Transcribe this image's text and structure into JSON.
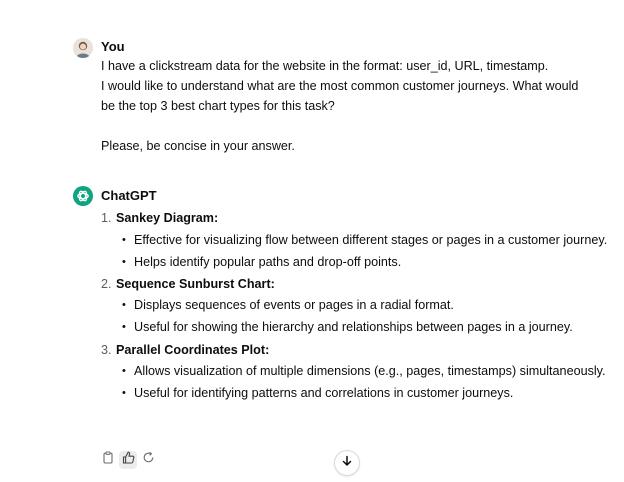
{
  "user_message": {
    "author": "You",
    "line1": "I have a clickstream data for the website in the format: user_id, URL, timestamp.",
    "line2": "I would like to understand what are the most common customer journeys. What would",
    "line3": "be the top 3 best chart types for this task?",
    "line4": "Please, be concise in your answer."
  },
  "assistant_message": {
    "author": "ChatGPT",
    "items": [
      {
        "number": "1.",
        "title": "Sankey Diagram:",
        "bullets": [
          "Effective for visualizing flow between different stages or pages in a customer journey.",
          "Helps identify popular paths and drop-off points."
        ]
      },
      {
        "number": "2.",
        "title": "Sequence Sunburst Chart:",
        "bullets": [
          "Displays sequences of events or pages in a radial format.",
          "Useful for showing the hierarchy and relationships between pages in a journey."
        ]
      },
      {
        "number": "3.",
        "title": "Parallel Coordinates Plot:",
        "bullets": [
          "Allows visualization of multiple dimensions (e.g., pages, timestamps) simultaneously.",
          "Useful for identifying patterns and correlations in customer journeys."
        ]
      }
    ]
  },
  "actions": {
    "copy_icon": "clipboard-icon",
    "like_icon": "thumbs-up-icon",
    "regenerate_icon": "regenerate-icon",
    "scroll_icon": "arrow-down-icon"
  },
  "colors": {
    "accent": "#10a37f",
    "text": "#0d0d0d",
    "muted": "#5d5d5d"
  }
}
